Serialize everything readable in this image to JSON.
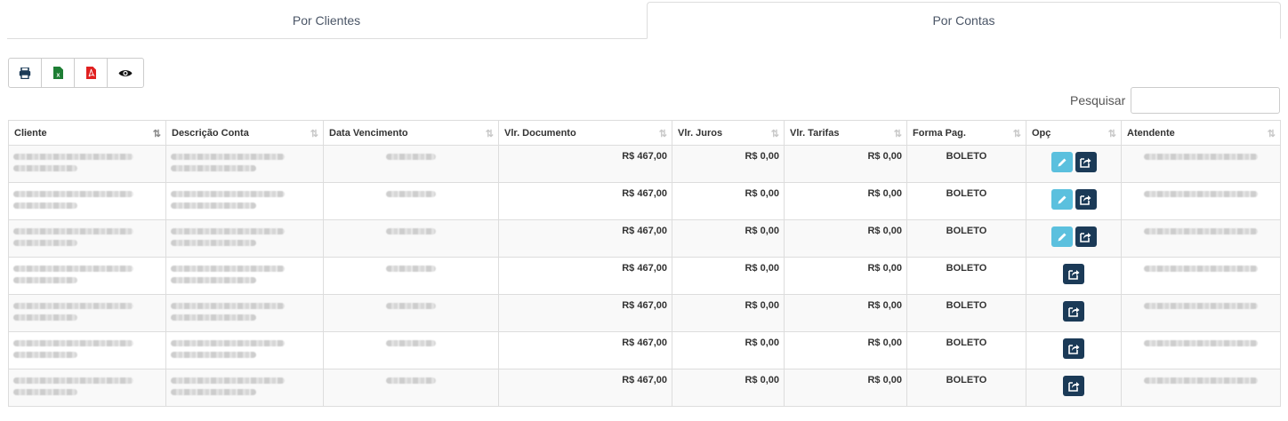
{
  "tabs": [
    {
      "label": "Por Clientes",
      "active": false
    },
    {
      "label": "Por Contas",
      "active": true
    }
  ],
  "toolbar": {
    "buttons": [
      {
        "icon": "print-icon",
        "color": "#1b3a57"
      },
      {
        "icon": "excel-icon",
        "color": "#1e7e34"
      },
      {
        "icon": "pdf-icon",
        "color": "#e02020"
      },
      {
        "icon": "eye-icon",
        "color": "#111111"
      }
    ]
  },
  "search": {
    "label": "Pesquisar",
    "value": ""
  },
  "table": {
    "columns": [
      "Cliente",
      "Descrição Conta",
      "Data Vencimento",
      "Vlr. Documento",
      "Vlr. Juros",
      "Vlr. Tarifas",
      "Forma Pag.",
      "Opç",
      "Atendente"
    ],
    "rows": [
      {
        "vlr_documento": "R$ 467,00",
        "vlr_juros": "R$ 0,00",
        "vlr_tarifas": "R$ 0,00",
        "forma_pag": "BOLETO",
        "editable": true
      },
      {
        "vlr_documento": "R$ 467,00",
        "vlr_juros": "R$ 0,00",
        "vlr_tarifas": "R$ 0,00",
        "forma_pag": "BOLETO",
        "editable": true
      },
      {
        "vlr_documento": "R$ 467,00",
        "vlr_juros": "R$ 0,00",
        "vlr_tarifas": "R$ 0,00",
        "forma_pag": "BOLETO",
        "editable": true
      },
      {
        "vlr_documento": "R$ 467,00",
        "vlr_juros": "R$ 0,00",
        "vlr_tarifas": "R$ 0,00",
        "forma_pag": "BOLETO",
        "editable": false
      },
      {
        "vlr_documento": "R$ 467,00",
        "vlr_juros": "R$ 0,00",
        "vlr_tarifas": "R$ 0,00",
        "forma_pag": "BOLETO",
        "editable": false
      },
      {
        "vlr_documento": "R$ 467,00",
        "vlr_juros": "R$ 0,00",
        "vlr_tarifas": "R$ 0,00",
        "forma_pag": "BOLETO",
        "editable": false
      },
      {
        "vlr_documento": "R$ 467,00",
        "vlr_juros": "R$ 0,00",
        "vlr_tarifas": "R$ 0,00",
        "forma_pag": "BOLETO",
        "editable": false
      }
    ]
  }
}
